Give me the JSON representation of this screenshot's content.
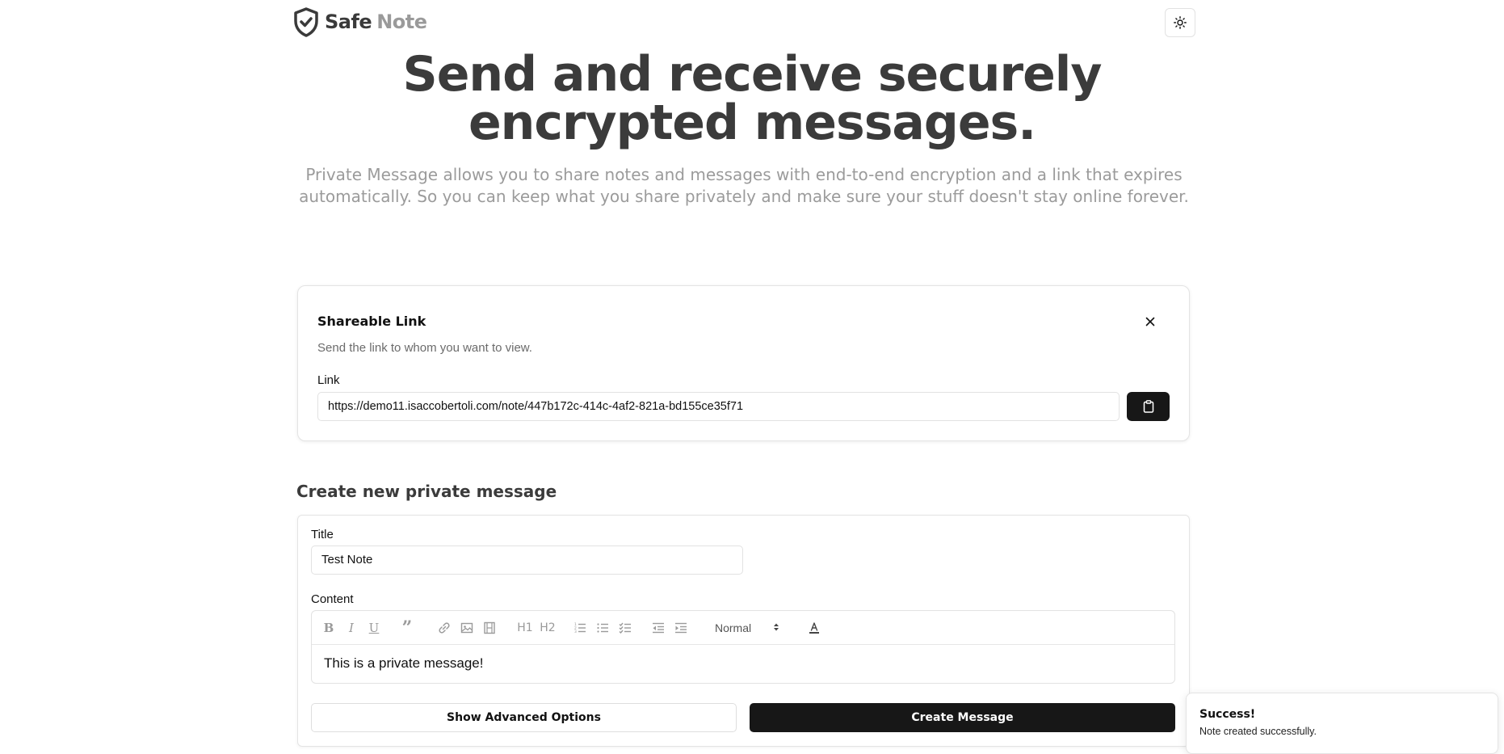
{
  "header": {
    "logo_safe": "Safe",
    "logo_note": "Note",
    "logo_icon": "shield-check-icon",
    "theme_icon": "sun-icon"
  },
  "hero": {
    "title_line1": "Send and receive securely",
    "title_line2": "encrypted messages.",
    "subtitle_line1": "Private Message allows you to share notes and messages with end-to-end encryption and a link that expires",
    "subtitle_line2": "automatically. So you can keep what you share privately and make sure your stuff doesn't stay online forever."
  },
  "share_card": {
    "title": "Shareable Link",
    "description": "Send the link to whom you want to view.",
    "link_label": "Link",
    "link_value": "https://demo11.isaccobertoli.com/note/447b172c-414c-4af2-821a-bd155ce35f71",
    "copy_icon": "clipboard-icon",
    "close_icon": "close-icon"
  },
  "form": {
    "section_title": "Create new private message",
    "title_label": "Title",
    "title_value": "Test Note",
    "content_label": "Content",
    "toolbar": {
      "bold": "B",
      "italic": "I",
      "underline": "U",
      "quote": "”",
      "header1": "H1",
      "header2": "H2",
      "size_select": "Normal"
    },
    "content_value": "This is a private message!",
    "advanced_button": "Show Advanced Options",
    "create_button": "Create Message"
  },
  "toast": {
    "title": "Success!",
    "message": "Note created successfully."
  },
  "colors": {
    "primary": "#171717",
    "heading": "#3b3b3b",
    "muted": "#9b9b9b",
    "border": "#e4e4e4"
  }
}
